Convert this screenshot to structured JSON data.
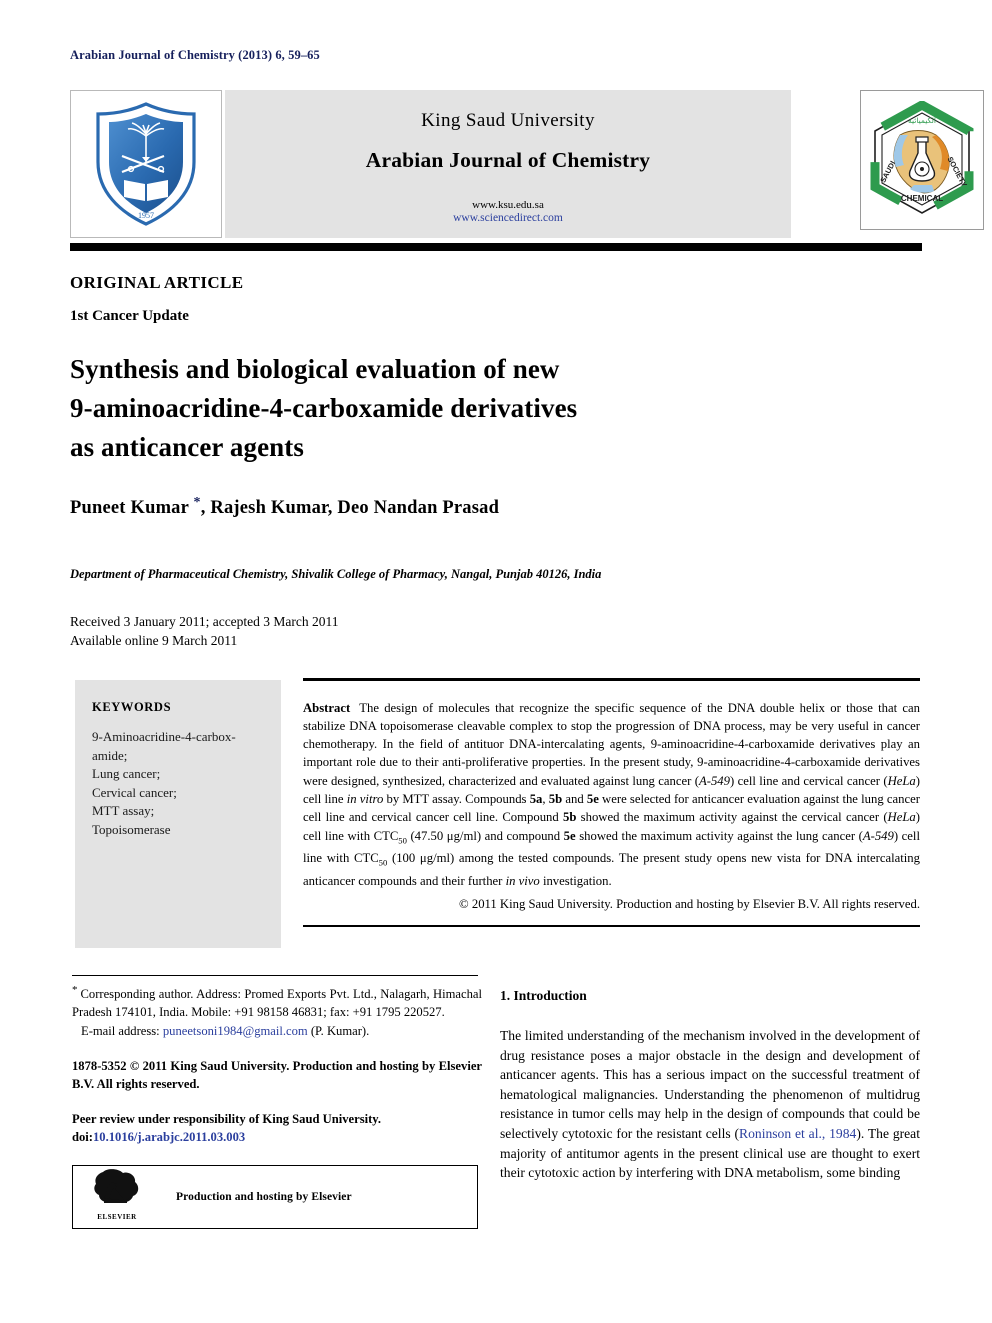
{
  "running_head": "Arabian Journal of Chemistry (2013) 6, 59–65",
  "masthead": {
    "university": "King Saud University",
    "journal": "Arabian Journal of Chemistry",
    "url_ksu": "www.ksu.edu.sa",
    "url_sciencedirect": "www.sciencedirect.com",
    "ksu_logo_year": "1957",
    "ksu_logo_alt": "King Saud University",
    "scs_logo_top": "الكيميائية",
    "scs_logo_left": "SAUDI",
    "scs_logo_right": "SOCIETY",
    "scs_logo_bottom": "CHEMICAL"
  },
  "article": {
    "kicker": "ORIGINAL ARTICLE",
    "subkicker": "1st Cancer Update",
    "title_line1": "Synthesis and biological evaluation of new",
    "title_line2": "9-aminoacridine-4-carboxamide derivatives",
    "title_line3": "as anticancer agents",
    "authors_before_star": "Puneet Kumar ",
    "author_star": "*",
    "authors_after_star": ", Rajesh Kumar, Deo Nandan Prasad",
    "affiliation": "Department of Pharmaceutical Chemistry, Shivalik College of Pharmacy, Nangal, Punjab 40126, India",
    "received": "Received 3 January 2011; accepted 3 March 2011",
    "available": "Available online 9 March 2011"
  },
  "keywords": {
    "heading": "KEYWORDS",
    "items": [
      "9-Aminoacridine-4-carbox-",
      "amide;",
      "Lung cancer;",
      "Cervical cancer;",
      "MTT assay;",
      "Topoisomerase"
    ]
  },
  "abstract": {
    "label": "Abstract",
    "p1": "The design of molecules that recognize the specific sequence of the DNA double helix or those that can stabilize DNA topoisomerase cleavable complex to stop the progression of DNA process, may be very useful in cancer chemotherapy. In the field of antituor DNA-intercalating agents, 9-aminoacridine-4-carboxamide derivatives play an important role due to their anti-proliferative properties. In the present study, 9-aminoacridine-4-carboxamide derivatives were designed, synthesized, characterized and evaluated against lung cancer (",
    "cell_a549_1": "A-549",
    "p2": ") cell line and cervical cancer (",
    "cell_hela_1": "HeLa",
    "p3": ") cell line ",
    "in_vitro": "in vitro",
    "p4": " by MTT assay. Compounds ",
    "cmp_5a": "5a",
    "p5": ", ",
    "cmp_5b": "5b",
    "p6": " and ",
    "cmp_5e": "5e",
    "p7": " were selected for anticancer evaluation against the lung cancer cell line and cervical cancer cell line. Compound ",
    "cmp_5b_2": "5b",
    "p8": " showed the maximum activity against the cervical cancer (",
    "cell_hela_2": "HeLa",
    "p9": ") cell line with CTC",
    "sub_50_a": "50",
    "p10": " (47.50 μg/ml) and compound ",
    "cmp_5e_2": "5e",
    "p11": " showed the maximum activity against the lung cancer (",
    "cell_a549_2": "A-549",
    "p12": ") cell line with CTC",
    "sub_50_b": "50",
    "p13": " (100 μg/ml) among the tested compounds. The present study opens new vista for DNA intercalating anticancer compounds and their further ",
    "in_vivo": "in vivo",
    "p14": " investigation.",
    "copyright": "© 2011 King Saud University. Production and hosting by Elsevier B.V. All rights reserved."
  },
  "footnotes": {
    "corr_star": "*",
    "corr_text": "Corresponding author. Address: Promed Exports Pvt. Ltd., Nalagarh, Himachal Pradesh 174101, India. Mobile: +91 98158 46831; fax: +91 1795 220527.",
    "email_label": "E-mail address:",
    "email": "puneetsoni1984@gmail.com",
    "email_suffix": "(P. Kumar).",
    "issn": "1878-5352 © 2011 King Saud University. Production and hosting by Elsevier B.V. All rights reserved.",
    "peer_review": "Peer review under responsibility of King Saud University.",
    "doi_label": "doi:",
    "doi_value": "10.1016/j.arabjc.2011.03.003",
    "elsevier_banner": "Production and hosting by Elsevier",
    "elsevier_wordmark": "ELSEVIER"
  },
  "introduction": {
    "heading": "1. Introduction",
    "text_before_cite": "The limited understanding of the mechanism involved in the development of drug resistance poses a major obstacle in the design and development of anticancer agents. This has a serious impact on the successful treatment of hematological malignancies. Understanding the phenomenon of multidrug resistance in tumor cells may help in the design of compounds that could be selectively cytotoxic for the resistant cells (",
    "citation": "Roninson et al., 1984",
    "text_after_cite": "). The great majority of antitumor agents in the present clinical use are thought to exert their cytotoxic action by interfering with DNA metabolism, some binding"
  },
  "colors": {
    "navy": "#16205c",
    "link_blue": "#2b3f9e",
    "masthead_gray": "#e3e3e3",
    "logo_blue": "#2a6ab0",
    "scs_green": "#2e9b4e"
  }
}
